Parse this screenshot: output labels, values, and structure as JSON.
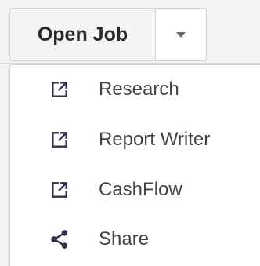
{
  "split_button": {
    "label": "Open Job"
  },
  "menu": {
    "items": [
      {
        "label": "Research",
        "icon": "open-external-icon"
      },
      {
        "label": "Report Writer",
        "icon": "open-external-icon"
      },
      {
        "label": "CashFlow",
        "icon": "open-external-icon"
      },
      {
        "label": "Share",
        "icon": "share-icon"
      }
    ]
  },
  "colors": {
    "icon": "#2f2f4a",
    "text": "#444444"
  }
}
